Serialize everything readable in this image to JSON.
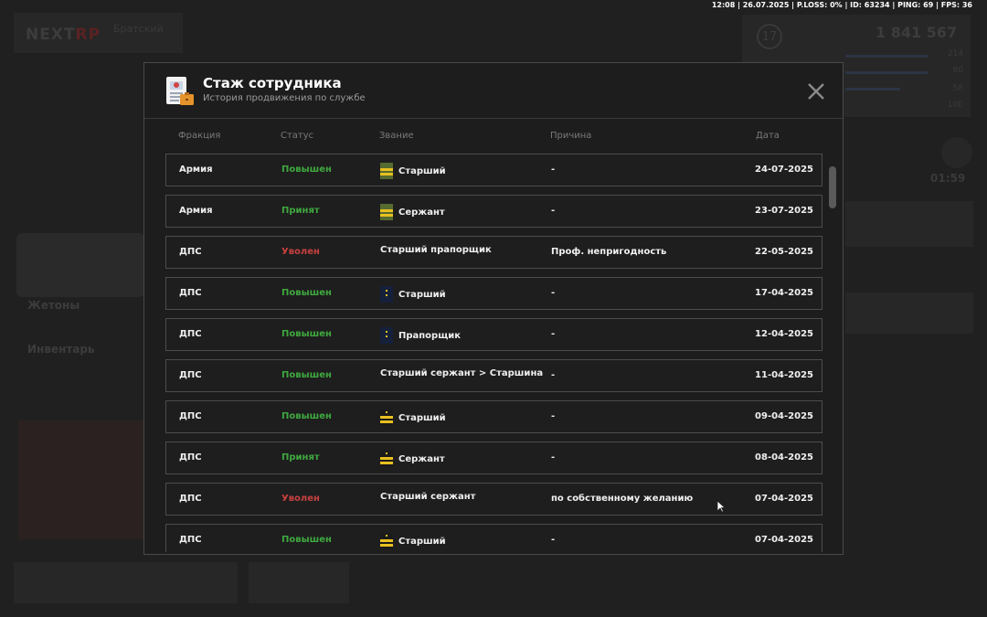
{
  "topbar": {
    "text": "12:08 | 26.07.2025 | P.LOSS: 0% | ID: 63234 | PING: 69 | FPS: 36"
  },
  "background": {
    "logo_left": "NEXT",
    "logo_right": "RP",
    "server": "Братский",
    "level": "17",
    "money": "1 841 567",
    "stats": [
      "214",
      "80",
      "58",
      "100"
    ],
    "timer": "01:59",
    "label_tokens": "Жетоны",
    "label_inventory": "Инвентарь"
  },
  "modal": {
    "title": "Стаж сотрудника",
    "subtitle": "История продвижения по службе",
    "columns": {
      "faction": "Фракция",
      "status": "Статус",
      "rank": "Звание",
      "reason": "Причина",
      "date": "Дата"
    },
    "rows": [
      {
        "faction": "Армия",
        "status": "Повышен",
        "status_color": "green",
        "rank": "Старший",
        "icon": "army-stripes",
        "reason": "-",
        "date": "24-07-2025"
      },
      {
        "faction": "Армия",
        "status": "Принят",
        "status_color": "green",
        "rank": "Сержант",
        "icon": "army-stripes",
        "reason": "-",
        "date": "23-07-2025"
      },
      {
        "faction": "ДПС",
        "status": "Уволен",
        "status_color": "red",
        "rank": "Старший прапорщик",
        "icon": "",
        "reason": "Проф. непригодность",
        "date": "22-05-2025"
      },
      {
        "faction": "ДПС",
        "status": "Повышен",
        "status_color": "green",
        "rank": "Старший",
        "icon": "navy-epaulet",
        "reason": "-",
        "date": "17-04-2025"
      },
      {
        "faction": "ДПС",
        "status": "Повышен",
        "status_color": "green",
        "rank": "Прапорщик",
        "icon": "navy-epaulet",
        "reason": "-",
        "date": "12-04-2025"
      },
      {
        "faction": "ДПС",
        "status": "Повышен",
        "status_color": "green",
        "rank": "Старший сержант > Старшина",
        "icon": "",
        "reason": "-",
        "date": "11-04-2025"
      },
      {
        "faction": "ДПС",
        "status": "Повышен",
        "status_color": "green",
        "rank": "Старший",
        "icon": "gold-stripes",
        "reason": "-",
        "date": "09-04-2025"
      },
      {
        "faction": "ДПС",
        "status": "Принят",
        "status_color": "green",
        "rank": "Сержант",
        "icon": "gold-stripes",
        "reason": "-",
        "date": "08-04-2025"
      },
      {
        "faction": "ДПС",
        "status": "Уволен",
        "status_color": "red",
        "rank": "Старший сержант",
        "icon": "",
        "reason": "по собственному желанию",
        "date": "07-04-2025"
      },
      {
        "faction": "ДПС",
        "status": "Повышен",
        "status_color": "green",
        "rank": "Старший",
        "icon": "gold-stripes",
        "reason": "-",
        "date": "07-04-2025"
      }
    ]
  },
  "colors": {
    "status_green": "#3fa83f",
    "status_red": "#c84040",
    "modal_bg": "#1d1d1d",
    "row_border": "#4c4c4c"
  }
}
